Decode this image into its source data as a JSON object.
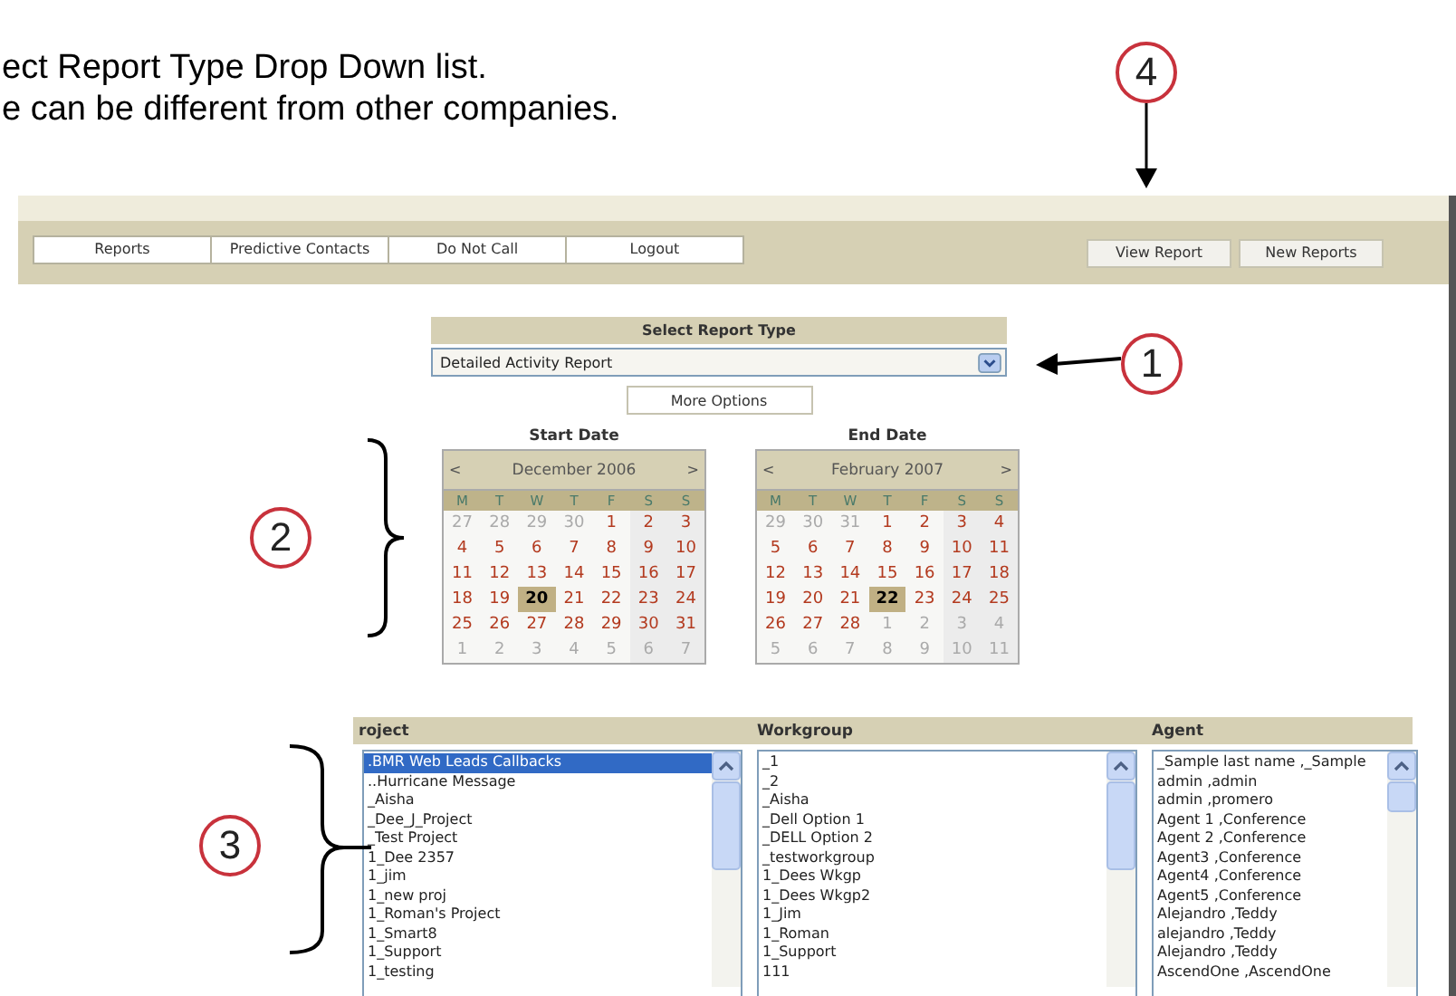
{
  "doc_text": [
    "ect Report Type Drop Down list.",
    "e can be different from other companies."
  ],
  "nav": {
    "tabs": [
      {
        "label": "Reports",
        "selected": false
      },
      {
        "label": "Predictive Contacts",
        "selected": false
      },
      {
        "label": "Do Not Call",
        "selected": false
      },
      {
        "label": "Logout",
        "selected": false
      }
    ],
    "buttons": [
      "View Report",
      "New Reports"
    ]
  },
  "report_type": {
    "label": "Select Report Type",
    "value": "Detailed Activity Report",
    "more_button": "More Options"
  },
  "calendars": [
    {
      "label": "Start Date",
      "prev": "<",
      "next": ">",
      "month": "December 2006",
      "weekdays": [
        "M",
        "T",
        "W",
        "T",
        "F",
        "S",
        "S"
      ],
      "weeks": [
        [
          {
            "d": "27",
            "muted": true,
            "selected": false
          },
          {
            "d": "28",
            "muted": true,
            "selected": false
          },
          {
            "d": "29",
            "muted": true,
            "selected": false
          },
          {
            "d": "30",
            "muted": true,
            "selected": false
          },
          {
            "d": "1",
            "muted": false,
            "selected": false
          },
          {
            "d": "2",
            "muted": false,
            "selected": false
          },
          {
            "d": "3",
            "muted": false,
            "selected": false
          }
        ],
        [
          {
            "d": "4",
            "muted": false,
            "selected": false
          },
          {
            "d": "5",
            "muted": false,
            "selected": false
          },
          {
            "d": "6",
            "muted": false,
            "selected": false
          },
          {
            "d": "7",
            "muted": false,
            "selected": false
          },
          {
            "d": "8",
            "muted": false,
            "selected": false
          },
          {
            "d": "9",
            "muted": false,
            "selected": false
          },
          {
            "d": "10",
            "muted": false,
            "selected": false
          }
        ],
        [
          {
            "d": "11",
            "muted": false,
            "selected": false
          },
          {
            "d": "12",
            "muted": false,
            "selected": false
          },
          {
            "d": "13",
            "muted": false,
            "selected": false
          },
          {
            "d": "14",
            "muted": false,
            "selected": false
          },
          {
            "d": "15",
            "muted": false,
            "selected": false
          },
          {
            "d": "16",
            "muted": false,
            "selected": false
          },
          {
            "d": "17",
            "muted": false,
            "selected": false
          }
        ],
        [
          {
            "d": "18",
            "muted": false,
            "selected": false
          },
          {
            "d": "19",
            "muted": false,
            "selected": false
          },
          {
            "d": "20",
            "muted": false,
            "selected": true
          },
          {
            "d": "21",
            "muted": false,
            "selected": false
          },
          {
            "d": "22",
            "muted": false,
            "selected": false
          },
          {
            "d": "23",
            "muted": false,
            "selected": false
          },
          {
            "d": "24",
            "muted": false,
            "selected": false
          }
        ],
        [
          {
            "d": "25",
            "muted": false,
            "selected": false
          },
          {
            "d": "26",
            "muted": false,
            "selected": false
          },
          {
            "d": "27",
            "muted": false,
            "selected": false
          },
          {
            "d": "28",
            "muted": false,
            "selected": false
          },
          {
            "d": "29",
            "muted": false,
            "selected": false
          },
          {
            "d": "30",
            "muted": false,
            "selected": false
          },
          {
            "d": "31",
            "muted": false,
            "selected": false
          }
        ],
        [
          {
            "d": "1",
            "muted": true,
            "selected": false
          },
          {
            "d": "2",
            "muted": true,
            "selected": false
          },
          {
            "d": "3",
            "muted": true,
            "selected": false
          },
          {
            "d": "4",
            "muted": true,
            "selected": false
          },
          {
            "d": "5",
            "muted": true,
            "selected": false
          },
          {
            "d": "6",
            "muted": true,
            "selected": false
          },
          {
            "d": "7",
            "muted": true,
            "selected": false
          }
        ]
      ]
    },
    {
      "label": "End Date",
      "prev": "<",
      "next": ">",
      "month": "February 2007",
      "weekdays": [
        "M",
        "T",
        "W",
        "T",
        "F",
        "S",
        "S"
      ],
      "weeks": [
        [
          {
            "d": "29",
            "muted": true,
            "selected": false
          },
          {
            "d": "30",
            "muted": true,
            "selected": false
          },
          {
            "d": "31",
            "muted": true,
            "selected": false
          },
          {
            "d": "1",
            "muted": false,
            "selected": false
          },
          {
            "d": "2",
            "muted": false,
            "selected": false
          },
          {
            "d": "3",
            "muted": false,
            "selected": false
          },
          {
            "d": "4",
            "muted": false,
            "selected": false
          }
        ],
        [
          {
            "d": "5",
            "muted": false,
            "selected": false
          },
          {
            "d": "6",
            "muted": false,
            "selected": false
          },
          {
            "d": "7",
            "muted": false,
            "selected": false
          },
          {
            "d": "8",
            "muted": false,
            "selected": false
          },
          {
            "d": "9",
            "muted": false,
            "selected": false
          },
          {
            "d": "10",
            "muted": false,
            "selected": false
          },
          {
            "d": "11",
            "muted": false,
            "selected": false
          }
        ],
        [
          {
            "d": "12",
            "muted": false,
            "selected": false
          },
          {
            "d": "13",
            "muted": false,
            "selected": false
          },
          {
            "d": "14",
            "muted": false,
            "selected": false
          },
          {
            "d": "15",
            "muted": false,
            "selected": false
          },
          {
            "d": "16",
            "muted": false,
            "selected": false
          },
          {
            "d": "17",
            "muted": false,
            "selected": false
          },
          {
            "d": "18",
            "muted": false,
            "selected": false
          }
        ],
        [
          {
            "d": "19",
            "muted": false,
            "selected": false
          },
          {
            "d": "20",
            "muted": false,
            "selected": false
          },
          {
            "d": "21",
            "muted": false,
            "selected": false
          },
          {
            "d": "22",
            "muted": false,
            "selected": true
          },
          {
            "d": "23",
            "muted": false,
            "selected": false
          },
          {
            "d": "24",
            "muted": false,
            "selected": false
          },
          {
            "d": "25",
            "muted": false,
            "selected": false
          }
        ],
        [
          {
            "d": "26",
            "muted": false,
            "selected": false
          },
          {
            "d": "27",
            "muted": false,
            "selected": false
          },
          {
            "d": "28",
            "muted": false,
            "selected": false
          },
          {
            "d": "1",
            "muted": true,
            "selected": false
          },
          {
            "d": "2",
            "muted": true,
            "selected": false
          },
          {
            "d": "3",
            "muted": true,
            "selected": false
          },
          {
            "d": "4",
            "muted": true,
            "selected": false
          }
        ],
        [
          {
            "d": "5",
            "muted": true,
            "selected": false
          },
          {
            "d": "6",
            "muted": true,
            "selected": false
          },
          {
            "d": "7",
            "muted": true,
            "selected": false
          },
          {
            "d": "8",
            "muted": true,
            "selected": false
          },
          {
            "d": "9",
            "muted": true,
            "selected": false
          },
          {
            "d": "10",
            "muted": true,
            "selected": false
          },
          {
            "d": "11",
            "muted": true,
            "selected": false
          }
        ]
      ]
    }
  ],
  "lists": [
    {
      "label": "roject",
      "items": [
        {
          "text": ".BMR Web Leads Callbacks",
          "selected": true
        },
        {
          "text": "..Hurricane Message",
          "selected": false
        },
        {
          "text": "_Aisha",
          "selected": false
        },
        {
          "text": "_Dee_J_Project",
          "selected": false
        },
        {
          "text": "_Test Project",
          "selected": false
        },
        {
          "text": "1_Dee 2357",
          "selected": false
        },
        {
          "text": "1_jim",
          "selected": false
        },
        {
          "text": "1_new proj",
          "selected": false
        },
        {
          "text": "1_Roman's Project",
          "selected": false
        },
        {
          "text": "1_Smart8",
          "selected": false
        },
        {
          "text": "1_Support",
          "selected": false
        },
        {
          "text": "1_testing",
          "selected": false
        }
      ]
    },
    {
      "label": "Workgroup",
      "items": [
        {
          "text": "_1",
          "selected": false
        },
        {
          "text": "_2",
          "selected": false
        },
        {
          "text": "_Aisha",
          "selected": false
        },
        {
          "text": "_Dell Option 1",
          "selected": false
        },
        {
          "text": "_DELL Option 2",
          "selected": false
        },
        {
          "text": "_testworkgroup",
          "selected": false
        },
        {
          "text": "1_Dees Wkgp",
          "selected": false
        },
        {
          "text": "1_Dees Wkgp2",
          "selected": false
        },
        {
          "text": "1_Jim",
          "selected": false
        },
        {
          "text": "1_Roman",
          "selected": false
        },
        {
          "text": "1_Support",
          "selected": false
        },
        {
          "text": "111",
          "selected": false
        }
      ]
    },
    {
      "label": "Agent",
      "items": [
        {
          "text": "_Sample last name ,_Sample",
          "selected": false
        },
        {
          "text": "admin ,admin",
          "selected": false
        },
        {
          "text": "admin ,promero",
          "selected": false
        },
        {
          "text": "Agent 1 ,Conference",
          "selected": false
        },
        {
          "text": "Agent 2 ,Conference",
          "selected": false
        },
        {
          "text": "Agent3 ,Conference",
          "selected": false
        },
        {
          "text": "Agent4 ,Conference",
          "selected": false
        },
        {
          "text": "Agent5 ,Conference",
          "selected": false
        },
        {
          "text": "Alejandro ,Teddy",
          "selected": false
        },
        {
          "text": "alejandro ,Teddy",
          "selected": false
        },
        {
          "text": "Alejandro ,Teddy",
          "selected": false
        },
        {
          "text": "AscendOne ,AscendOne",
          "selected": false
        }
      ]
    }
  ],
  "callouts": [
    "4",
    "1",
    "2",
    "3"
  ]
}
